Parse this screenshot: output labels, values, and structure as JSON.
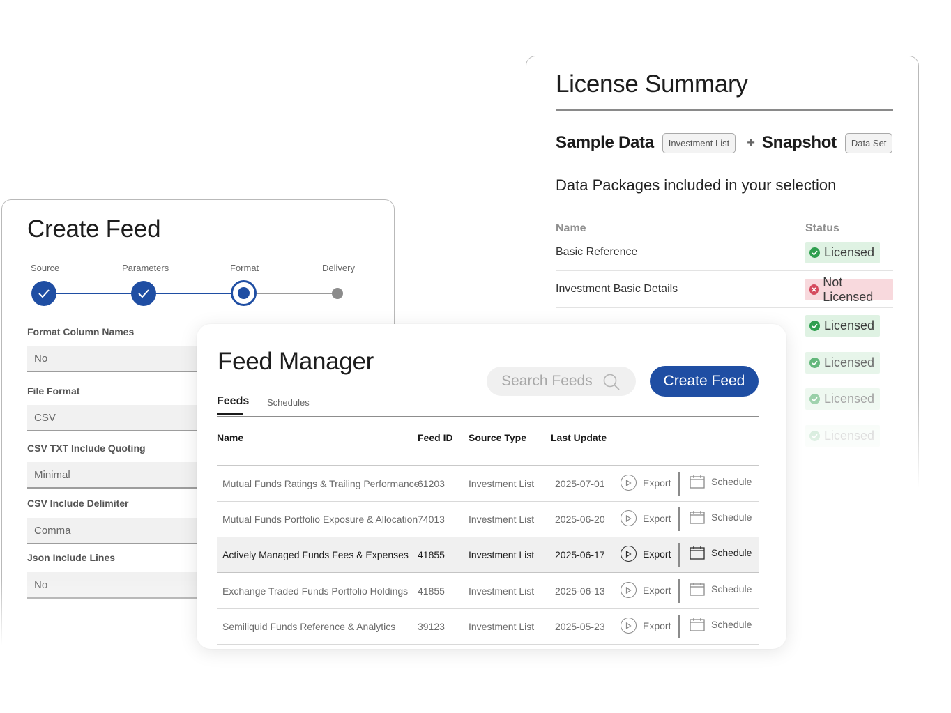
{
  "license": {
    "title": "License Summary",
    "selection": {
      "item1": "Sample Data",
      "tag1": "Investment List",
      "plus": "+",
      "item2": "Snapshot",
      "tag2": "Data Set"
    },
    "packages_heading": "Data Packages included in your selection",
    "columns": {
      "name": "Name",
      "status": "Status"
    },
    "rows": [
      {
        "name": "Basic Reference",
        "status": "Licensed",
        "licensed": true
      },
      {
        "name": "Investment Basic Details",
        "status": "Not Licensed",
        "licensed": false
      },
      {
        "name": "",
        "status": "Licensed",
        "licensed": true
      },
      {
        "name": "",
        "status": "Licensed",
        "licensed": true
      },
      {
        "name": "",
        "status": "Licensed",
        "licensed": true
      },
      {
        "name": "",
        "status": "Licensed",
        "licensed": true
      }
    ]
  },
  "create_feed": {
    "title": "Create Feed",
    "steps": [
      "Source",
      "Parameters",
      "Format",
      "Delivery"
    ],
    "fields": [
      {
        "label": "Format Column Names",
        "value": "No"
      },
      {
        "label": "File Format",
        "value": "CSV"
      },
      {
        "label": "CSV TXT Include Quoting",
        "value": "Minimal"
      },
      {
        "label": "CSV Include Delimiter",
        "value": "Comma"
      },
      {
        "label": "Json Include Lines",
        "value": "No"
      }
    ]
  },
  "feed_manager": {
    "title": "Feed Manager",
    "search_placeholder": "Search Feeds",
    "create_button": "Create Feed",
    "tabs": [
      "Feeds",
      "Schedules"
    ],
    "columns": [
      "Name",
      "Feed ID",
      "Source Type",
      "Last Update"
    ],
    "export_label": "Export",
    "schedule_label": "Schedule",
    "rows": [
      {
        "name": "Mutual Funds Ratings & Trailing Performance",
        "id": "61203",
        "source": "Investment List",
        "date": "2025-07-01"
      },
      {
        "name": "Mutual Funds Portfolio Exposure & Allocation",
        "id": "74013",
        "source": "Investment List",
        "date": "2025-06-20"
      },
      {
        "name": "Actively Managed Funds Fees & Expenses",
        "id": "41855",
        "source": "Investment List",
        "date": "2025-06-17"
      },
      {
        "name": "Exchange Traded Funds Portfolio Holdings",
        "id": "41855",
        "source": "Investment List",
        "date": "2025-06-13"
      },
      {
        "name": "Semiliquid Funds Reference & Analytics",
        "id": "39123",
        "source": "Investment List",
        "date": "2025-05-23"
      }
    ],
    "highlighted_row": 2
  },
  "colors": {
    "primary": "#1f4ea3",
    "licensed": "#2f9f4f",
    "not_licensed": "#d54b5e"
  }
}
